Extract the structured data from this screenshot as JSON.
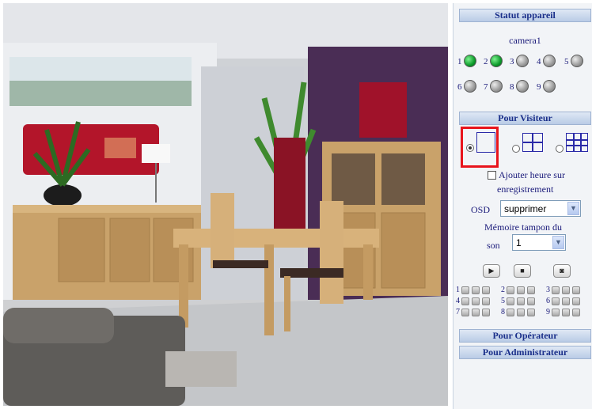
{
  "panel": {
    "device_status_title": "Statut appareil",
    "camera_label": "camera1",
    "cameras": [
      {
        "num": "1",
        "state": "on"
      },
      {
        "num": "2",
        "state": "on"
      },
      {
        "num": "3",
        "state": "off"
      },
      {
        "num": "4",
        "state": "off"
      },
      {
        "num": "5",
        "state": "off"
      },
      {
        "num": "6",
        "state": "off"
      },
      {
        "num": "7",
        "state": "off"
      },
      {
        "num": "8",
        "state": "off"
      },
      {
        "num": "9",
        "state": "off"
      }
    ],
    "visitor_title": "Pour Visiteur",
    "layouts": [
      "1x1",
      "2x2",
      "3x3"
    ],
    "selected_layout": "1x1",
    "add_time_label_line1": "Ajouter heure sur",
    "add_time_label_line2": "enregistrement",
    "osd_label": "OSD",
    "osd_value": "supprimer",
    "buffer_label_line1": "Mémoire tampon du",
    "buffer_label_line2": "son",
    "buffer_value": "1",
    "ptz_rows": [
      [
        "1",
        "2",
        "3"
      ],
      [
        "4",
        "5",
        "6"
      ],
      [
        "7",
        "8",
        "9"
      ]
    ],
    "operator_title": "Pour Opérateur",
    "admin_title": "Pour Administrateur"
  },
  "colors": {
    "online": "#0c9a2a",
    "offline": "#9a9a9a",
    "header_text": "#1a2f8a",
    "highlight": "#e8141c"
  }
}
